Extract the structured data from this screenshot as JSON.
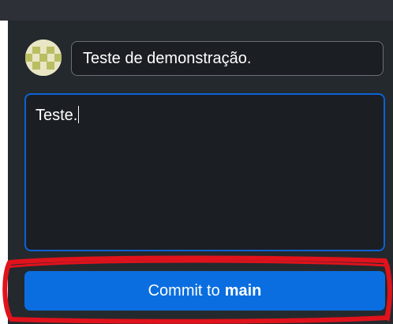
{
  "commit": {
    "summary_value": "Teste de demonstração.",
    "description_value": "Teste.",
    "button_prefix": "Commit to",
    "branch": "main"
  },
  "colors": {
    "panel_bg": "#24292e",
    "field_bg": "#1b1f23",
    "focus_border": "#0b61d6",
    "button_bg": "#0a6ee0",
    "annotation": "#e0121c"
  },
  "icons": {
    "avatar": "identicon-avatar"
  }
}
